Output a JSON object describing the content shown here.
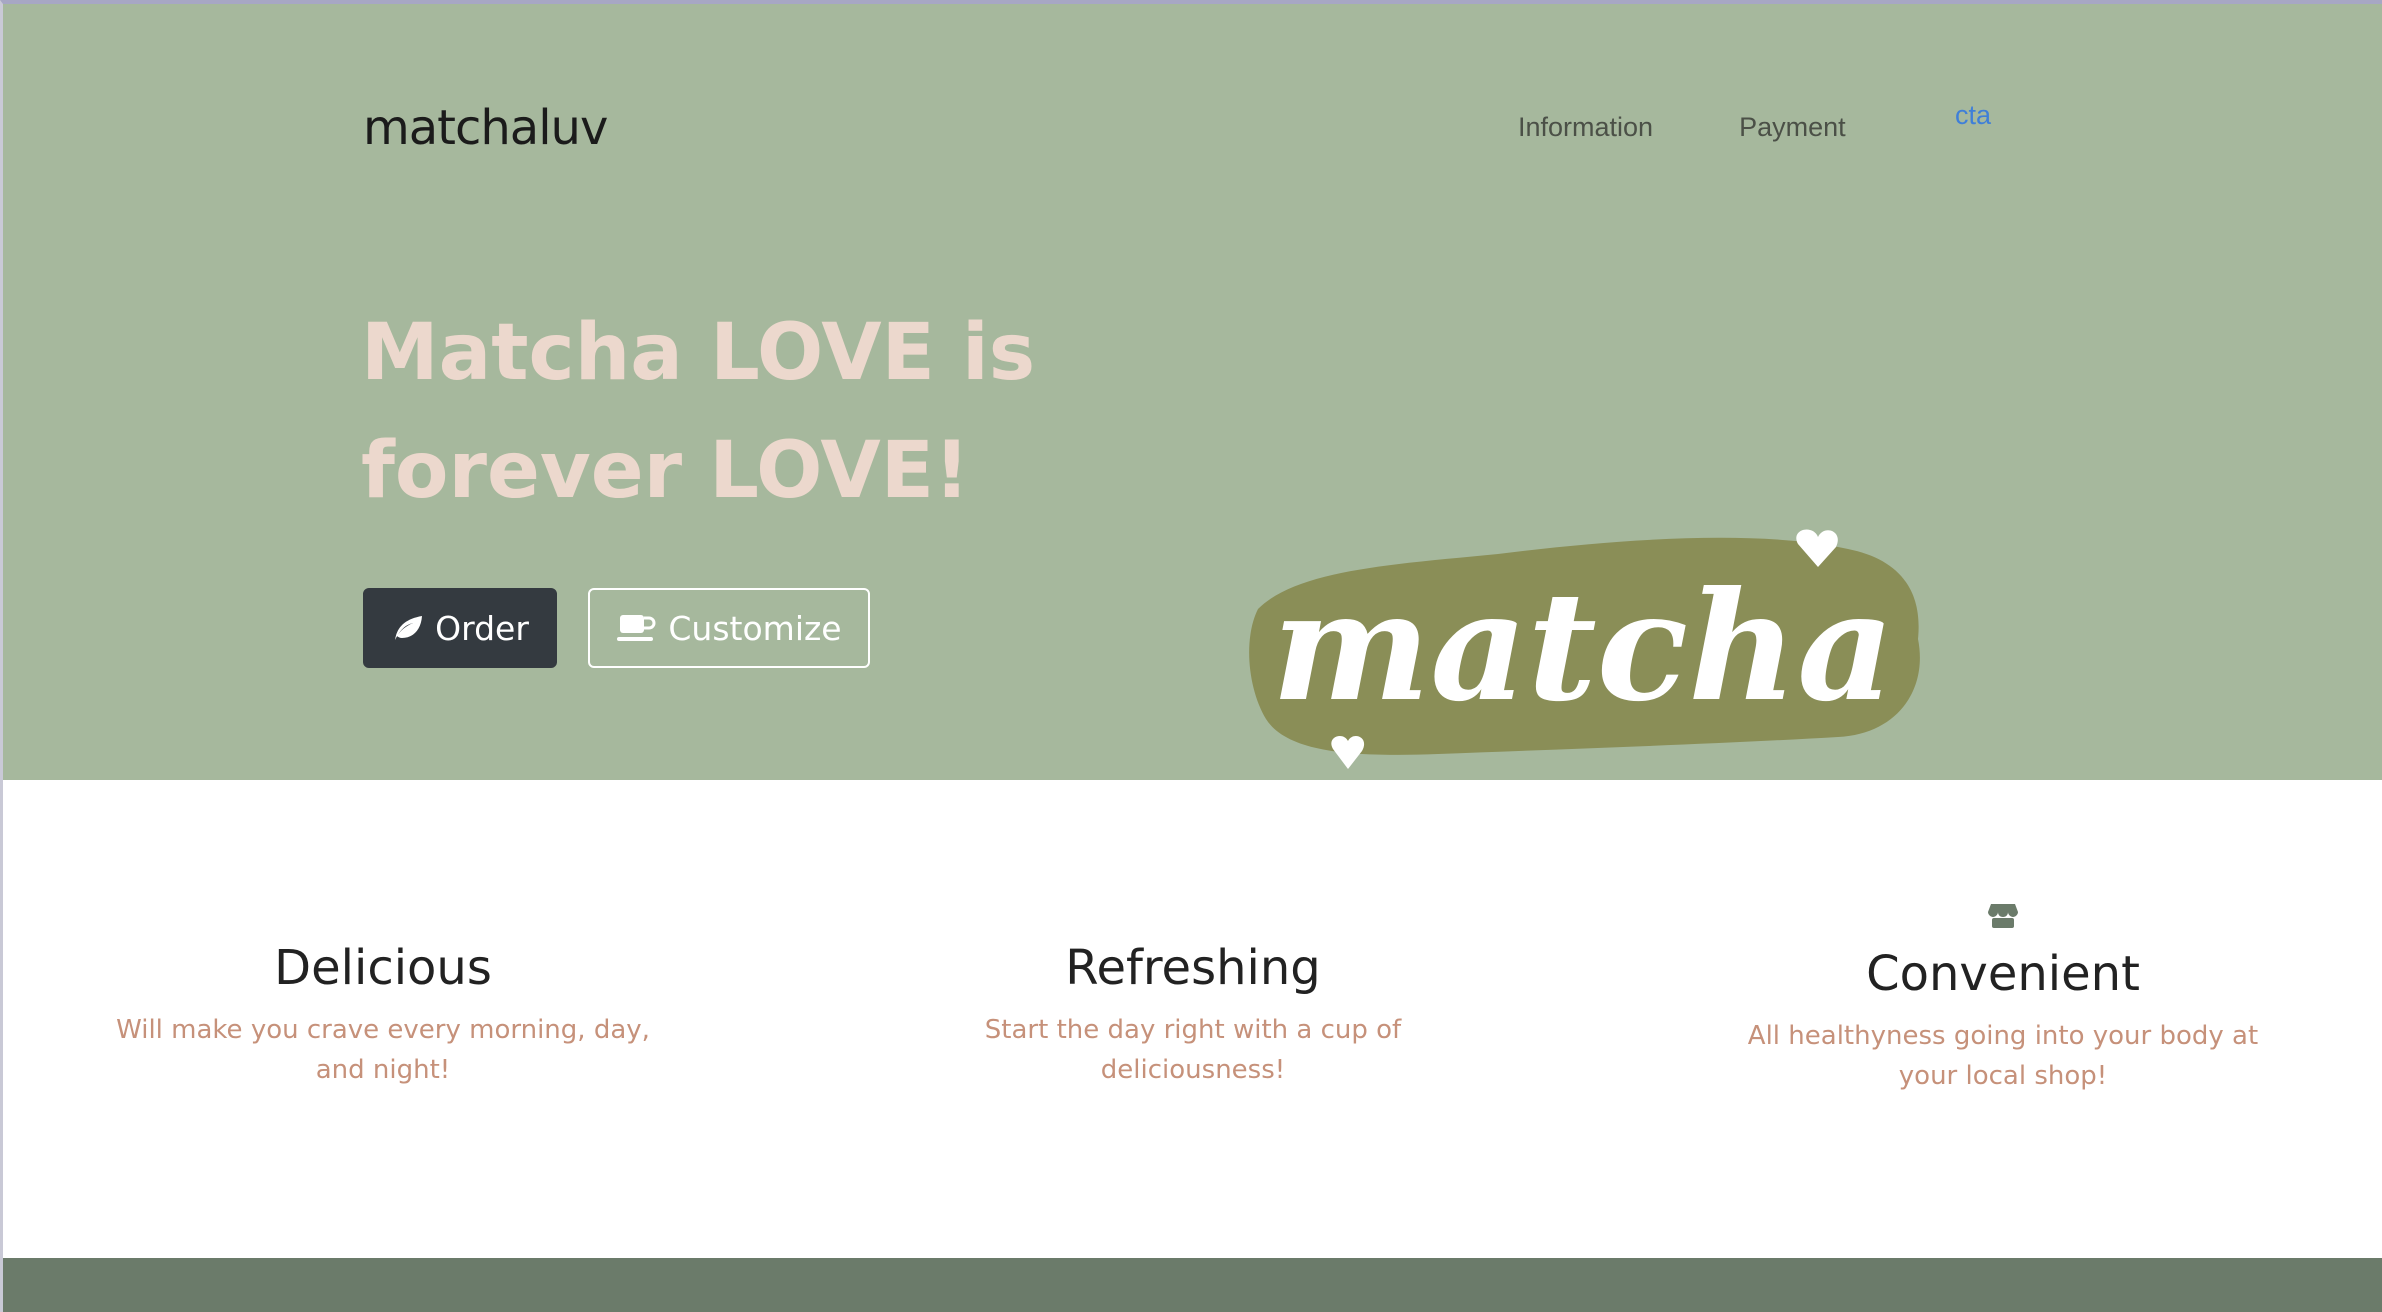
{
  "header": {
    "brand": "matchaluv",
    "nav": [
      {
        "label": "Information"
      },
      {
        "label": "Payment"
      },
      {
        "label": "cta"
      }
    ]
  },
  "hero": {
    "headline_line1": "Matcha LOVE is",
    "headline_line2": "forever LOVE!",
    "order_label": "Order",
    "customize_label": "Customize",
    "logo_text": "matcha"
  },
  "features": [
    {
      "title": "Delicious",
      "text": "Will make you crave every morning, day, and night!"
    },
    {
      "title": "Refreshing",
      "text": "Start the day right with a cup of deliciousness!"
    },
    {
      "title": "Convenient",
      "text": "All healthyness going into your body at your local shop!",
      "icon": "store-icon"
    }
  ],
  "colors": {
    "hero_bg": "#a6b89d",
    "headline": "#ecd8cd",
    "order_bg": "#343a40",
    "feature_text": "#c6917a",
    "footer_bg": "#6b7b6a",
    "cta": "#3f7fd8"
  }
}
